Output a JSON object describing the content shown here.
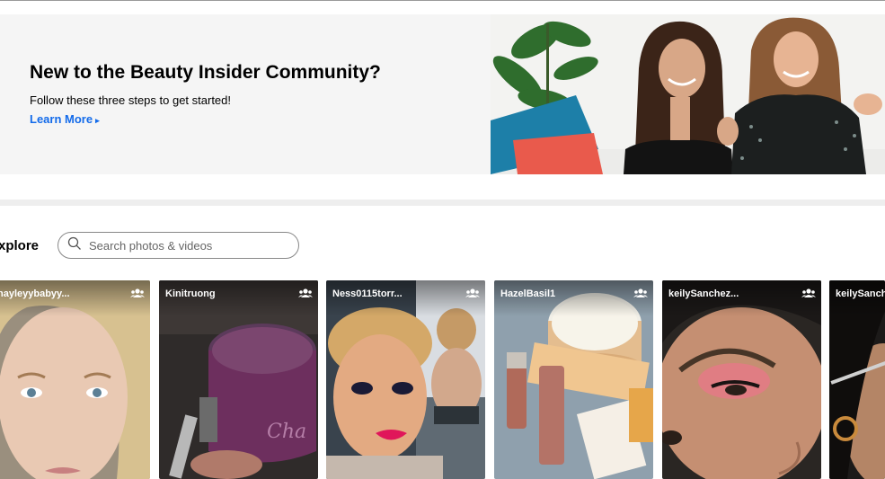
{
  "banner": {
    "title": "New to the Beauty Insider Community?",
    "subtitle": "Follow these three steps to get started!",
    "link_label": "Learn More",
    "link_arrow": "▸"
  },
  "explore": {
    "label": "xplore",
    "search_placeholder": "Search photos & videos"
  },
  "gallery": [
    {
      "username": "nayleyybabyy..."
    },
    {
      "username": "Kinitruong"
    },
    {
      "username": "Ness0115torr..."
    },
    {
      "username": "HazelBasil1"
    },
    {
      "username": "keilySanchez..."
    },
    {
      "username": "keilySanch"
    }
  ],
  "colors": {
    "link": "#136bea",
    "banner_bg": "#f5f5f5"
  }
}
